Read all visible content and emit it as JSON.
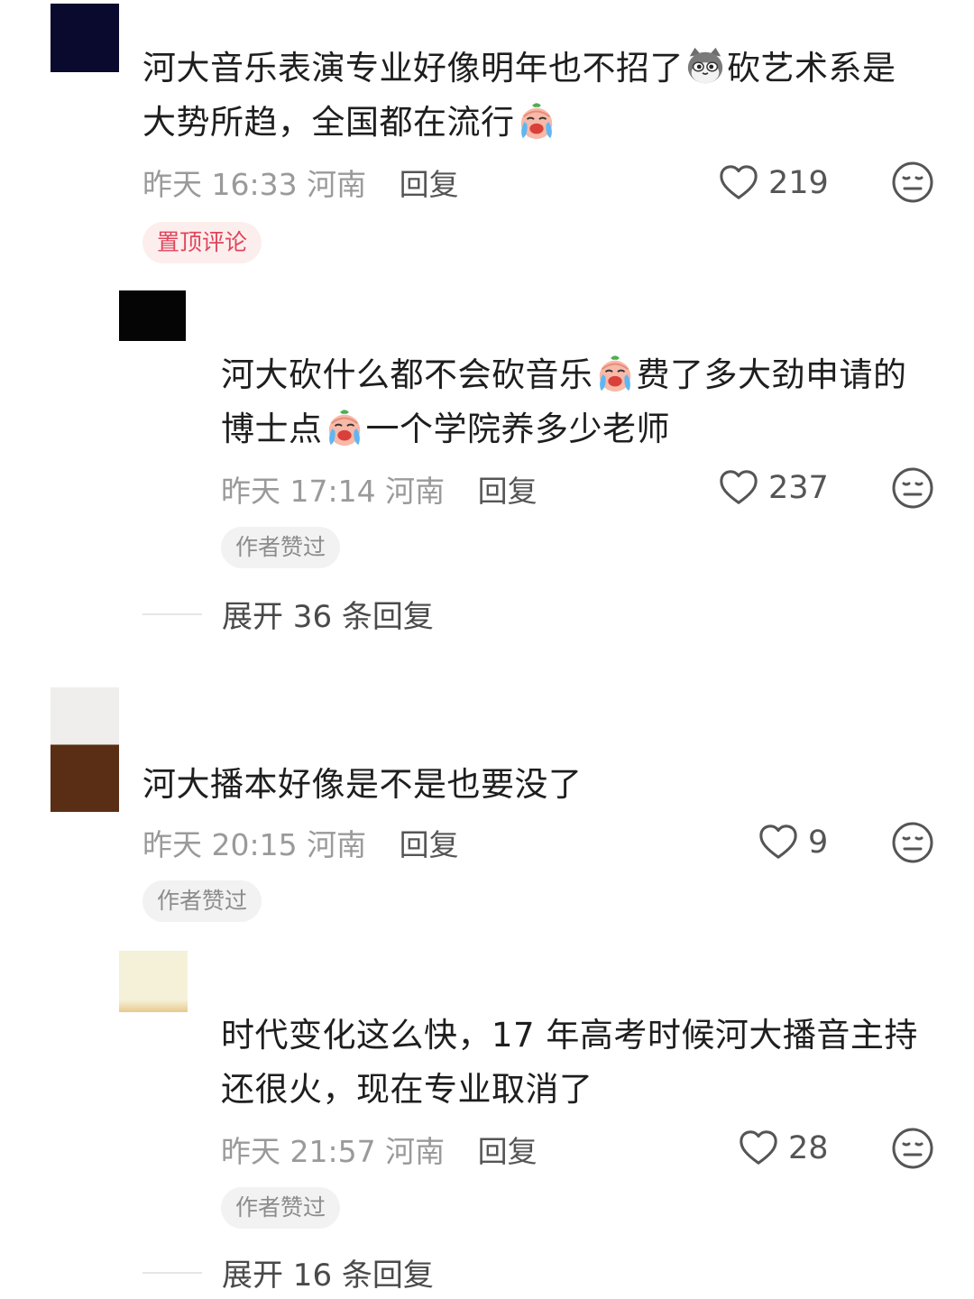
{
  "colors": {
    "pinned_tag_bg": "#fdeeee",
    "pinned_tag_text": "#e0455a",
    "author_tag_bg": "#f2f2f2",
    "meta_text": "#9a9a9a"
  },
  "icons": {
    "like": "heart-outline-icon",
    "dislike": "face-neutral-icon",
    "emoji_cat": "cat-emoji",
    "emoji_cry": "crying-emoji"
  },
  "comments": [
    {
      "text_line1_a": "河大音乐表演专业好像明年也不招了",
      "text_line1_b": "砍艺术系是",
      "text_line2_a": "大势所趋，全国都在流行",
      "time": "昨天 16:33",
      "location": "河南",
      "reply_label": "回复",
      "likes": "219",
      "tag": "置顶评论"
    },
    {
      "text_line1_a": "河大砍什么都不会砍音乐",
      "text_line1_b": "费了多大劲申请的",
      "text_line2_a": "博士点",
      "text_line2_b": "一个学院养多少老师",
      "time": "昨天 17:14",
      "location": "河南",
      "reply_label": "回复",
      "likes": "237",
      "tag": "作者赞过",
      "expand": "展开 36 条回复"
    },
    {
      "text_line1_a": "河大播本好像是不是也要没了",
      "time": "昨天 20:15",
      "location": "河南",
      "reply_label": "回复",
      "likes": "9",
      "tag": "作者赞过"
    },
    {
      "text_line1_a": "时代变化这么快，17 年高考时候河大播音主持",
      "text_line2_a": "还很火，现在专业取消了",
      "time": "昨天 21:57",
      "location": "河南",
      "reply_label": "回复",
      "likes": "28",
      "tag": "作者赞过",
      "expand": "展开 16 条回复"
    }
  ]
}
